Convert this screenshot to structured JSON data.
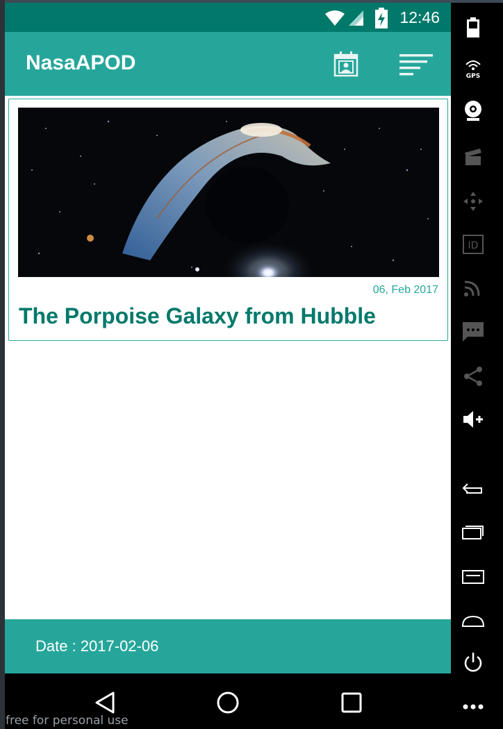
{
  "status_bar": {
    "time": "12:46",
    "icons": [
      "wifi-icon",
      "signal-icon",
      "battery-charging-icon"
    ]
  },
  "app_bar": {
    "title": "NasaAPOD",
    "actions": [
      "calendar-icon",
      "sort-icon"
    ]
  },
  "card": {
    "image_alt": "The Porpoise Galaxy from Hubble",
    "date": "06, Feb 2017",
    "title": "The Porpoise Galaxy from Hubble"
  },
  "bottom_bar": {
    "date_label": "Date : 2017-02-06"
  },
  "nav_bar": {
    "buttons": [
      "back-icon",
      "home-icon",
      "recents-icon"
    ]
  },
  "watermark": "free for personal use",
  "side_toolbar": {
    "gps_label": "GPS",
    "id_label": "ID",
    "tools": [
      "battery-icon",
      "gps-icon",
      "camera-icon",
      "clapper-icon",
      "dpad-icon",
      "id-icon",
      "cast-icon",
      "sms-icon",
      "share-icon",
      "volume-up-icon",
      "back-icon",
      "overview-icon",
      "menu-icon",
      "home-icon",
      "power-icon",
      "more-icon"
    ]
  },
  "colors": {
    "primary": "#26a69a",
    "primary_dark": "#00796b",
    "text_white": "#ffffff"
  }
}
